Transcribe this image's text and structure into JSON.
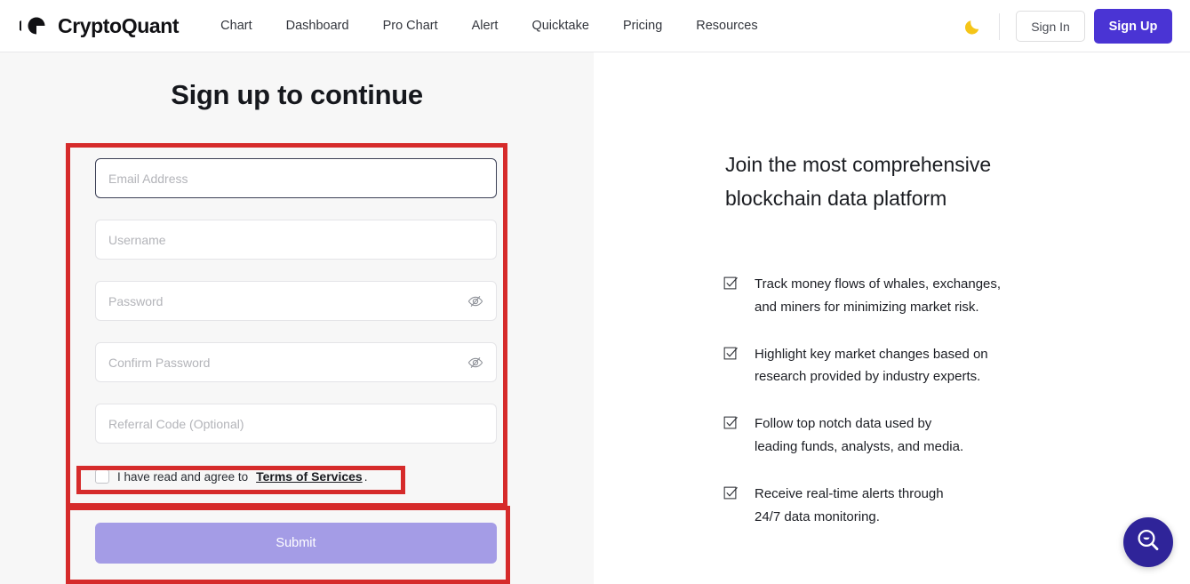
{
  "header": {
    "brand_name": "CryptoQuant",
    "brand_logo_icon": "cryptoquant-logo-icon",
    "nav": [
      {
        "label": "Chart"
      },
      {
        "label": "Dashboard"
      },
      {
        "label": "Pro Chart"
      },
      {
        "label": "Alert"
      },
      {
        "label": "Quicktake"
      },
      {
        "label": "Pricing"
      },
      {
        "label": "Resources"
      }
    ],
    "theme_toggle_icon": "moon-icon",
    "sign_in_label": "Sign In",
    "sign_up_label": "Sign Up",
    "accent_color": "#4a34d4",
    "moon_color": "#f5c518"
  },
  "signup": {
    "title": "Sign up to continue",
    "fields": [
      {
        "name": "email",
        "placeholder": "Email Address",
        "value": "",
        "focused": true,
        "has_eye": false
      },
      {
        "name": "username",
        "placeholder": "Username",
        "value": "",
        "focused": false,
        "has_eye": false
      },
      {
        "name": "password",
        "placeholder": "Password",
        "value": "",
        "focused": false,
        "has_eye": true
      },
      {
        "name": "confirm-password",
        "placeholder": "Confirm Password",
        "value": "",
        "focused": false,
        "has_eye": true
      },
      {
        "name": "referral",
        "placeholder": "Referral Code (Optional)",
        "value": "",
        "focused": false,
        "has_eye": false
      }
    ],
    "eye_icon": "eye-off-icon",
    "terms_prefix": "I have read and agree to",
    "terms_link": "Terms of Services",
    "terms_suffix": ".",
    "terms_checked": false,
    "submit_label": "Submit",
    "submit_color": "#a49ce6"
  },
  "promo": {
    "title_line_1": "Join the most comprehensive",
    "title_line_2": "blockchain data platform",
    "features": [
      {
        "icon": "checkbox-check-icon",
        "line_1": "Track money flows of whales, exchanges,",
        "line_2": "and miners for minimizing market risk."
      },
      {
        "icon": "checkbox-check-icon",
        "line_1": "Highlight key market changes based on",
        "line_2": "research provided by industry experts."
      },
      {
        "icon": "checkbox-check-icon",
        "line_1": "Follow top notch data used by",
        "line_2": "leading funds, analysts, and media."
      },
      {
        "icon": "checkbox-check-icon",
        "line_1": "Receive real-time alerts through",
        "line_2": "24/7 data monitoring."
      }
    ]
  },
  "help": {
    "icon": "search-smile-help-icon",
    "color": "#2f2499"
  },
  "annotations": {
    "color": "#d62b2b",
    "boxes": [
      {
        "name": "form-fields-highlight"
      },
      {
        "name": "terms-checkbox-highlight"
      },
      {
        "name": "submit-button-highlight"
      }
    ]
  }
}
